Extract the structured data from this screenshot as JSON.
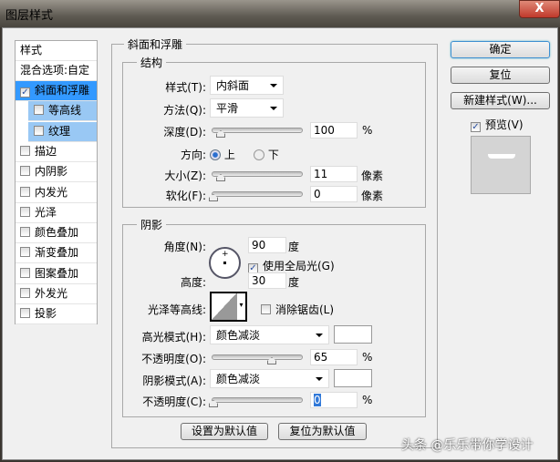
{
  "window": {
    "title": "图层样式",
    "close": "X"
  },
  "sidebar": {
    "header": "样式",
    "blend": "混合选项:自定",
    "items": [
      {
        "label": "斜面和浮雕",
        "checked": true,
        "selected": true
      },
      {
        "label": "等高线",
        "checked": false,
        "sub": true
      },
      {
        "label": "纹理",
        "checked": false,
        "sub": true
      },
      {
        "label": "描边",
        "checked": false
      },
      {
        "label": "内阴影",
        "checked": false
      },
      {
        "label": "内发光",
        "checked": false
      },
      {
        "label": "光泽",
        "checked": false
      },
      {
        "label": "颜色叠加",
        "checked": false
      },
      {
        "label": "渐变叠加",
        "checked": false
      },
      {
        "label": "图案叠加",
        "checked": false
      },
      {
        "label": "外发光",
        "checked": false
      },
      {
        "label": "投影",
        "checked": false
      }
    ]
  },
  "bevel": {
    "title": "斜面和浮雕",
    "structure": {
      "title": "结构",
      "style_label": "样式(T):",
      "style_value": "内斜面",
      "technique_label": "方法(Q):",
      "technique_value": "平滑",
      "depth_label": "深度(D):",
      "depth_value": "100",
      "depth_unit": "%",
      "direction_label": "方向:",
      "dir_up": "上",
      "dir_down": "下",
      "size_label": "大小(Z):",
      "size_value": "11",
      "size_unit": "像素",
      "soften_label": "软化(F):",
      "soften_value": "0",
      "soften_unit": "像素"
    },
    "shading": {
      "title": "阴影",
      "angle_label": "角度(N):",
      "angle_value": "90",
      "angle_unit": "度",
      "global_light": "使用全局光(G)",
      "altitude_label": "高度:",
      "altitude_value": "30",
      "altitude_unit": "度",
      "gloss_label": "光泽等高线:",
      "antialias": "消除锯齿(L)",
      "highlight_label": "高光模式(H):",
      "highlight_mode": "颜色减淡",
      "highlight_opacity_label": "不透明度(O):",
      "highlight_opacity": "65",
      "shadow_label": "阴影模式(A):",
      "shadow_mode": "颜色减淡",
      "shadow_opacity_label": "不透明度(C):",
      "shadow_opacity": "0",
      "pct": "%"
    },
    "make_default": "设置为默认值",
    "reset_default": "复位为默认值"
  },
  "actions": {
    "ok": "确定",
    "reset": "复位",
    "new_style": "新建样式(W)...",
    "preview": "预览(V)"
  },
  "watermark": "头条 @乐乐带你学设计"
}
